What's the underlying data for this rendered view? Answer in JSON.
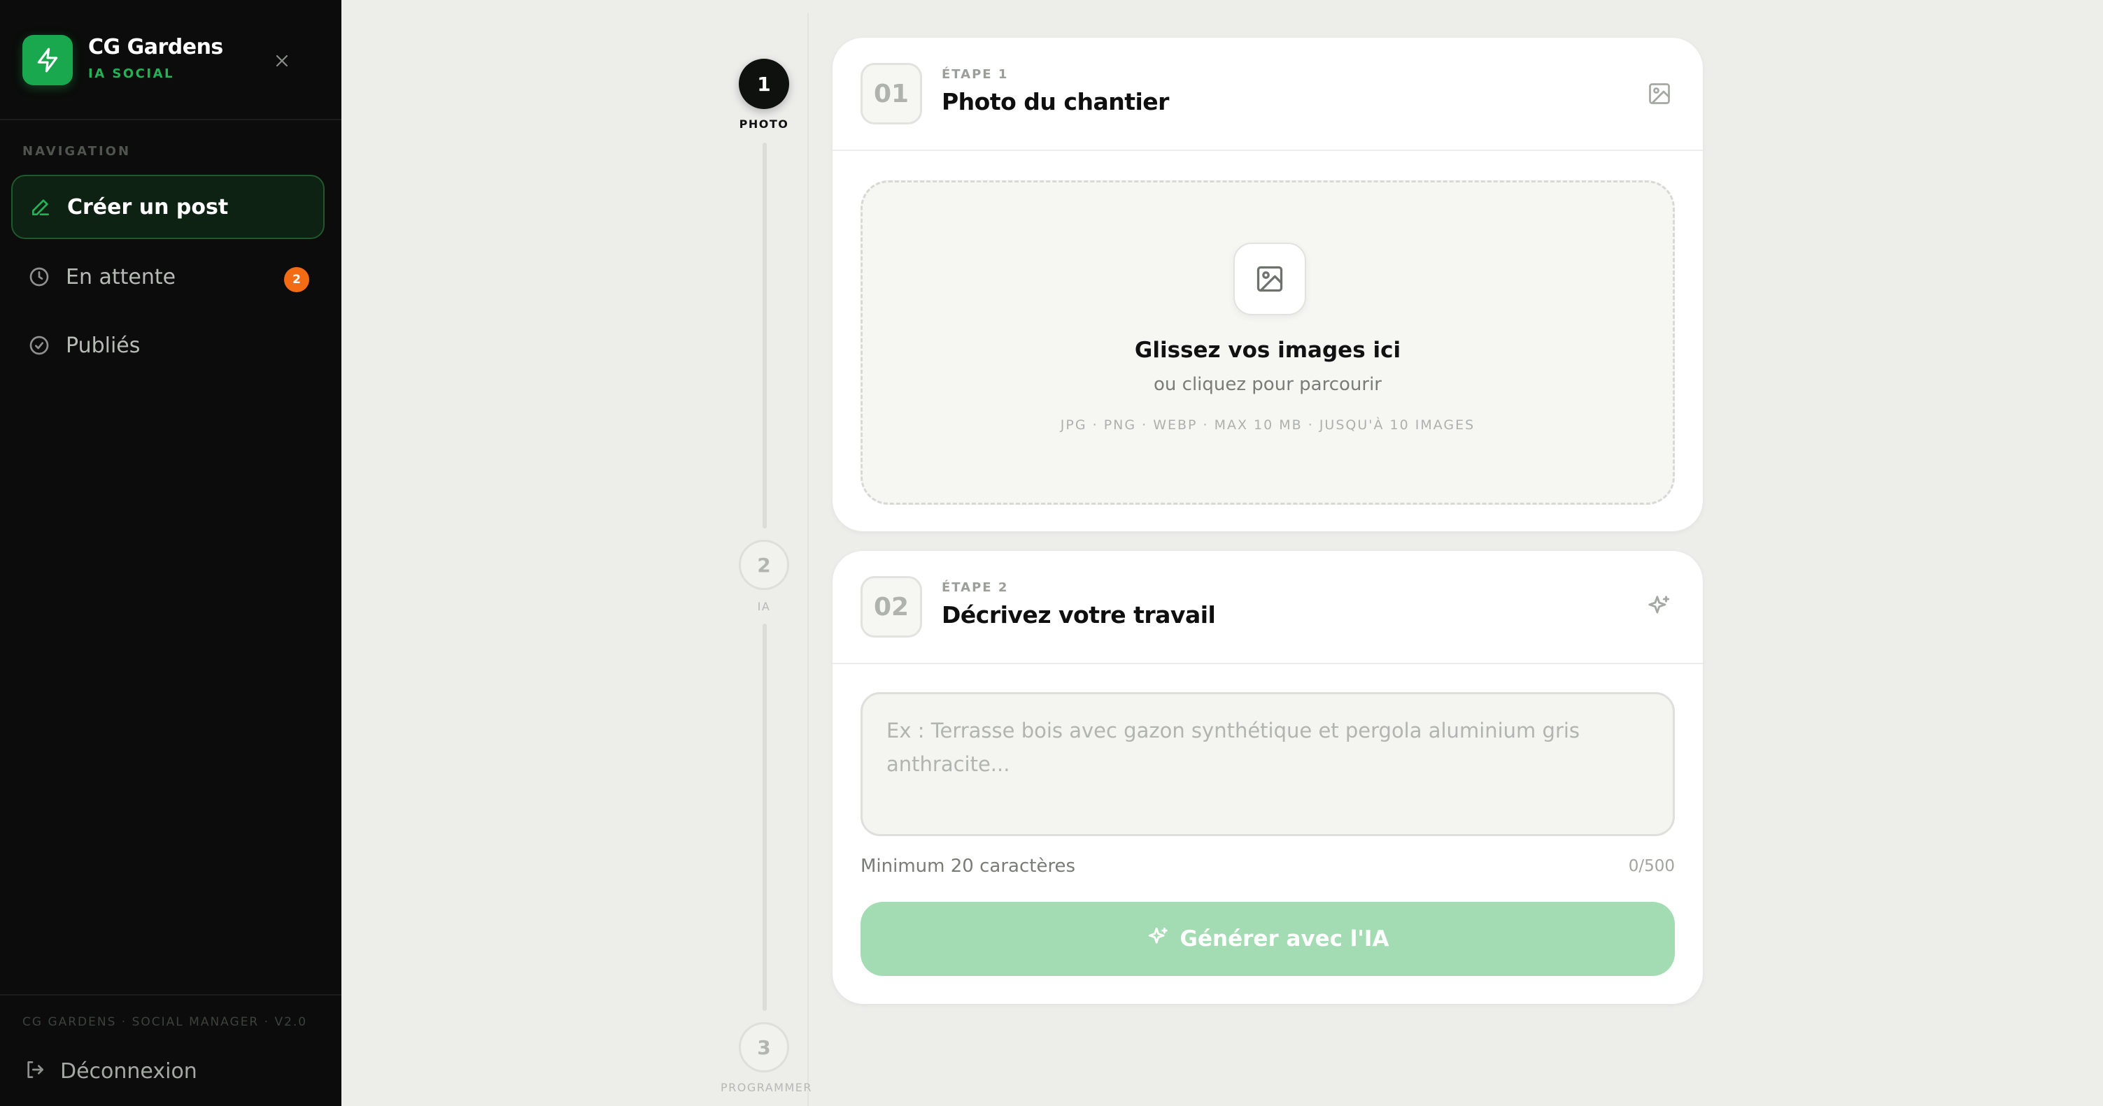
{
  "app": {
    "name": "CG Gardens",
    "subtitle": "IA SOCIAL"
  },
  "sidebar": {
    "heading": "NAVIGATION",
    "items": [
      {
        "label": "Créer un post",
        "icon": "pen-icon",
        "active": true
      },
      {
        "label": "En attente",
        "icon": "clock-icon",
        "badge": "2"
      },
      {
        "label": "Publiés",
        "icon": "check-circle-icon"
      }
    ],
    "version": "CG GARDENS · SOCIAL MANAGER · V2.0",
    "logout_label": "Déconnexion"
  },
  "stepper": {
    "steps": [
      {
        "number": "1",
        "label": "PHOTO",
        "active": true
      },
      {
        "number": "2",
        "label": "IA",
        "active": false
      },
      {
        "number": "3",
        "label": "PROGRAMMER",
        "active": false
      }
    ]
  },
  "card1": {
    "number": "01",
    "tag": "ÉTAPE 1",
    "title": "Photo du chantier",
    "dropzone": {
      "title": "Glissez vos images ici",
      "subtitle": "ou cliquez pour parcourir",
      "formats": "JPG · PNG · WEBP · MAX 10 MB · JUSQU'À 10 IMAGES"
    }
  },
  "card2": {
    "number": "02",
    "tag": "ÉTAPE 2",
    "title": "Décrivez votre travail",
    "textarea": {
      "value": "",
      "placeholder": "Ex : Terrasse bois avec gazon synthétique et pergola aluminium gris anthracite..."
    },
    "hint": "Minimum 20 caractères",
    "counter": "0/500",
    "button_label": "Générer avec l'IA"
  },
  "colors": {
    "sidebar_bg": "#0b0c0b",
    "accent": "#1aa84f",
    "badge": "#f36c14",
    "button_disabled": "#a3dcb2",
    "page_bg": "#ededea"
  }
}
